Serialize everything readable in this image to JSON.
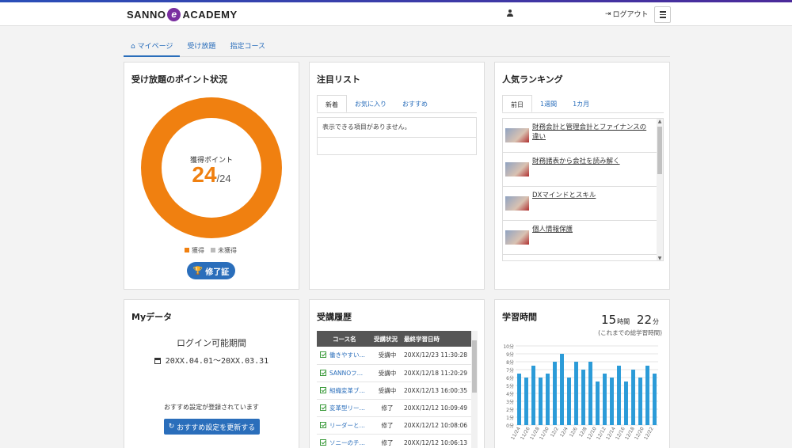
{
  "header": {
    "logo_text_left": "SANNO",
    "logo_mark": "e",
    "logo_text_right": "ACADEMY",
    "user_icon": "user-icon",
    "logout_label": "ログアウト",
    "logout_icon": "sign-out-icon",
    "menu_icon": "hamburger-icon"
  },
  "tabs": [
    {
      "label": "マイページ",
      "icon": "home-icon"
    },
    {
      "label": "受け放題"
    },
    {
      "label": "指定コース"
    }
  ],
  "points": {
    "title": "受け放題のポイント状況",
    "label": "獲得ポイント",
    "value": "24",
    "total": "/24",
    "fraction_earned": 1.0,
    "legend": [
      "獲得",
      "未獲得"
    ],
    "colors": {
      "earned": "#f08010",
      "unearned": "#bbbbbb"
    },
    "button_label": "修了証",
    "button_icon": "trophy-icon"
  },
  "watchlist": {
    "title": "注目リスト",
    "tabs": [
      "新着",
      "お気に入り",
      "おすすめ"
    ],
    "empty_text": "表示できる項目がありません。"
  },
  "ranking": {
    "title": "人気ランキング",
    "tabs": [
      "前日",
      "1週間",
      "1カ月"
    ],
    "items": [
      "財務会計と管理会計とファイナンスの違い",
      "財務諸表から会社を読み解く",
      "DXマインドとスキル",
      "個人情報保護"
    ]
  },
  "mydata": {
    "title": "Myデータ",
    "period_label": "ログイン可能期間",
    "period_value": "20XX.04.01～20XX.03.31",
    "note": "おすすめ設定が登録されています",
    "button_label": "おすすめ設定を更新する",
    "button_icon": "refresh-icon"
  },
  "history": {
    "title": "受講履歴",
    "columns": [
      "コース名",
      "受講状況",
      "最終学習日時"
    ],
    "rows": [
      [
        "働きやすい…",
        "受講中",
        "20XX/12/23 11:30:28"
      ],
      [
        "SANNOフ…",
        "受講中",
        "20XX/12/18 11:20:29"
      ],
      [
        "組織変革ブ…",
        "受講中",
        "20XX/12/13 16:00:35"
      ],
      [
        "変革型リー…",
        "修了",
        "20XX/12/12 10:09:49"
      ],
      [
        "リーダーと…",
        "修了",
        "20XX/12/12 10:08:06"
      ],
      [
        "ソニーのチ…",
        "修了",
        "20XX/12/12 10:06:13"
      ]
    ]
  },
  "study": {
    "title": "学習時間",
    "hours": "15",
    "hours_unit": "時間",
    "minutes": "22",
    "minutes_unit": "分",
    "note": "(これまでの総学習時間)"
  },
  "chart_data": {
    "type": "bar",
    "ylim": [
      0,
      10
    ],
    "y_ticks": [
      "0分",
      "1分",
      "2分",
      "3分",
      "4分",
      "5分",
      "6分",
      "7分",
      "8分",
      "9分",
      "10分"
    ],
    "categories": [
      "11/24",
      "11/26",
      "11/28",
      "11/30",
      "12/2",
      "12/4",
      "12/6",
      "12/8",
      "12/10",
      "12/12",
      "12/14",
      "12/16",
      "12/18",
      "12/20",
      "12/22"
    ],
    "values": [
      6.5,
      6,
      7.5,
      6,
      6.5,
      8,
      9,
      6,
      8,
      7,
      8,
      5.5,
      6.5,
      6,
      7.5,
      5.5,
      7,
      6,
      7.5,
      6.5
    ],
    "color": "#2b9bd8",
    "grid": true
  }
}
